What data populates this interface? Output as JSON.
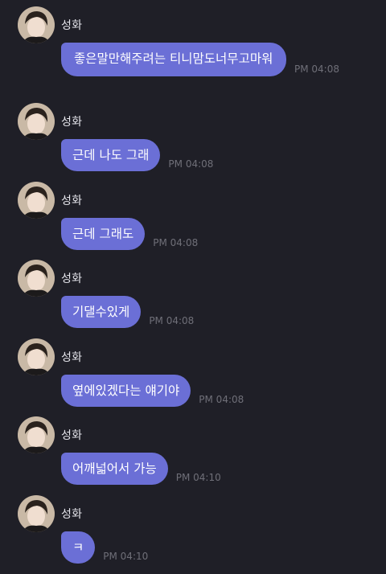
{
  "sender_name": "성화",
  "messages": [
    {
      "text": "좋은말만해주려는 티니맘도너무고마워",
      "time": "PM 04:08"
    },
    {
      "text": "근데 나도 그래",
      "time": "PM 04:08"
    },
    {
      "text": "근데 그래도",
      "time": "PM 04:08"
    },
    {
      "text": "기댈수있게",
      "time": "PM 04:08"
    },
    {
      "text": "옆에있겠다는 얘기야",
      "time": "PM 04:08"
    },
    {
      "text": "어깨넓어서 가능",
      "time": "PM 04:10"
    },
    {
      "text": "ㅋ",
      "time": "PM 04:10"
    }
  ],
  "colors": {
    "background": "#1f1f27",
    "bubble": "#6b6fd6",
    "timestamp": "#6f6f78"
  }
}
